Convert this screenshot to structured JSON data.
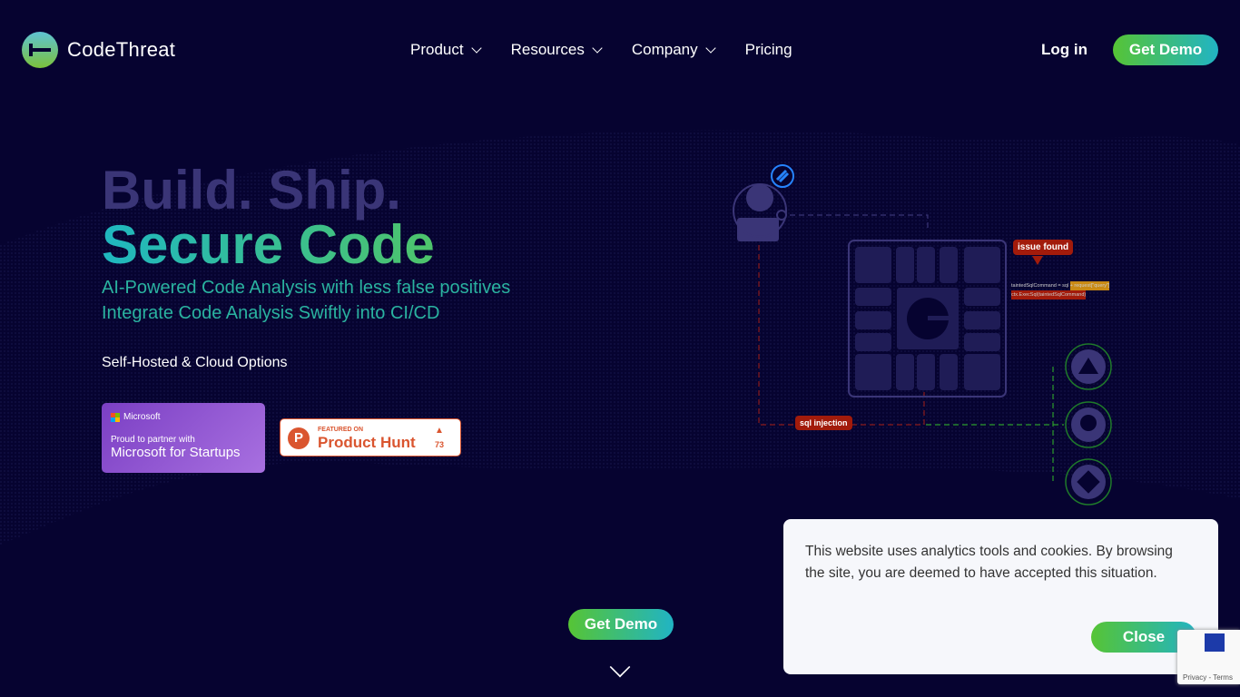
{
  "nav": {
    "brand": "CodeThreat",
    "menu": [
      {
        "label": "Product"
      },
      {
        "label": "Resources"
      },
      {
        "label": "Company"
      },
      {
        "label": "Pricing"
      }
    ],
    "login": "Log in",
    "demo": "Get Demo"
  },
  "hero": {
    "line1": "Build. Ship.",
    "line2": "Secure Code",
    "sub1": "AI-Powered Code Analysis with less false positives",
    "sub2": "Integrate Code Analysis Swiftly into CI/CD",
    "options": "Self-Hosted & Cloud Options",
    "cta": "Get Demo"
  },
  "badges": {
    "microsoft": {
      "brand": "Microsoft",
      "pre": "Proud to partner with",
      "title": "Microsoft for Startups"
    },
    "producthunt": {
      "featured": "FEATURED ON",
      "name": "Product Hunt",
      "count": "73"
    }
  },
  "diagram": {
    "issue": "issue found",
    "sql": "sql injection",
    "code1": "taintedSqlCommand = sql + request[\"query\"]",
    "code2": "ctx.ExecSql(taintedSqlCommand)",
    "icons": [
      "azure-icon",
      "github-icon",
      "git-icon",
      "jira-icon",
      "developer-icon"
    ]
  },
  "cookie": {
    "text": "This website uses analytics tools and cookies. By browsing the site, you are deemed to have accepted this situation.",
    "close": "Close"
  },
  "recaptcha": {
    "links": "Privacy - Terms"
  },
  "colors": {
    "background": "#060330",
    "accent_green": "#56c435",
    "accent_teal": "#21b4c4",
    "alert_red": "#a21b0b"
  }
}
